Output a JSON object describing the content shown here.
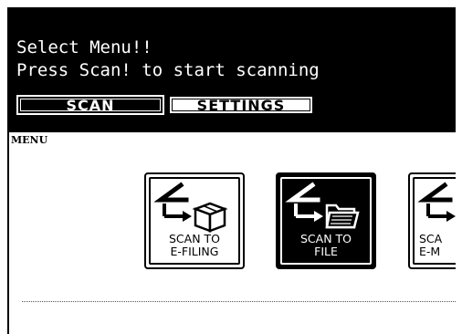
{
  "message": {
    "line1": "Select Menu!!",
    "line2": "Press Scan! to start scanning"
  },
  "tabs": [
    {
      "label": "SCAN",
      "selected": true
    },
    {
      "label": "SETTINGS",
      "selected": false
    }
  ],
  "menu_label": "MENU",
  "buttons": [
    {
      "line1": "SCAN TO",
      "line2": "E-FILING",
      "icon": "efiling-box-icon",
      "selected": false
    },
    {
      "line1": "SCAN TO",
      "line2": "FILE",
      "icon": "folder-icon",
      "selected": true
    },
    {
      "line1": "SCA",
      "line2": "E-M",
      "icon": "email-icon",
      "selected": false
    }
  ],
  "colors": {
    "background": "#000000",
    "foreground": "#ffffff"
  }
}
